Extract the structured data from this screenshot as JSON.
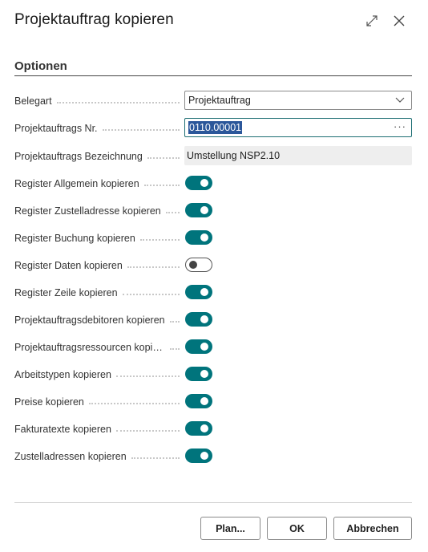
{
  "dialog": {
    "title": "Projektauftrag kopieren",
    "section": "Optionen"
  },
  "fields": {
    "belegart": {
      "label": "Belegart",
      "value": "Projektauftrag"
    },
    "nr": {
      "label": "Projektauftrags Nr.",
      "value": "0110.00001"
    },
    "bezeichnung": {
      "label": "Projektauftrags Bezeichnung",
      "value": "Umstellung NSP2.10"
    }
  },
  "toggles": [
    {
      "label": "Register Allgemein kopieren",
      "on": true
    },
    {
      "label": "Register Zustelladresse kopieren",
      "on": true
    },
    {
      "label": "Register Buchung kopieren",
      "on": true
    },
    {
      "label": "Register Daten kopieren",
      "on": false
    },
    {
      "label": "Register Zeile kopieren",
      "on": true
    },
    {
      "label": "Projektauftragsdebitoren kopieren",
      "on": true
    },
    {
      "label": "Projektauftragsressourcen kopier...",
      "on": true
    },
    {
      "label": "Arbeitstypen kopieren",
      "on": true
    },
    {
      "label": "Preise kopieren",
      "on": true
    },
    {
      "label": "Fakturatexte kopieren",
      "on": true
    },
    {
      "label": "Zustelladressen kopieren",
      "on": true
    }
  ],
  "buttons": {
    "plan": "Plan...",
    "ok": "OK",
    "cancel": "Abbrechen"
  },
  "icons": {
    "expand": "expand-icon",
    "close": "close-icon",
    "dropdown": "chevron-down-icon",
    "more": "ellipsis-icon"
  },
  "colors": {
    "toggle_on": "#00747c",
    "selection": "#2b579a"
  }
}
